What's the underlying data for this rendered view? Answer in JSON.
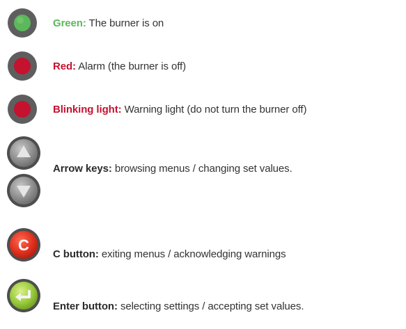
{
  "colors": {
    "green": "#5bb85b",
    "red": "#c4122f",
    "ring": "#5e5e5e",
    "text": "#333333",
    "label_dark": "#2b2b2b"
  },
  "legend": [
    {
      "icon": "green-light-icon",
      "label": "Green:",
      "desc": "The burner is on"
    },
    {
      "icon": "red-light-icon",
      "label": "Red:",
      "desc": "Alarm (the burner is off)"
    },
    {
      "icon": "blinking-light-icon",
      "label": "Blinking light:",
      "desc": "Warning light (do not turn the burner off)"
    },
    {
      "icon": "arrow-keys-icon",
      "label": "Arrow keys:",
      "desc": "browsing menus / changing set values."
    },
    {
      "icon": "c-button-icon",
      "label": "C button:",
      "desc": "exiting menus / acknowledging warnings",
      "glyph": "C"
    },
    {
      "icon": "enter-button-icon",
      "label": "Enter button:",
      "desc": "selecting settings / accepting set values."
    }
  ]
}
